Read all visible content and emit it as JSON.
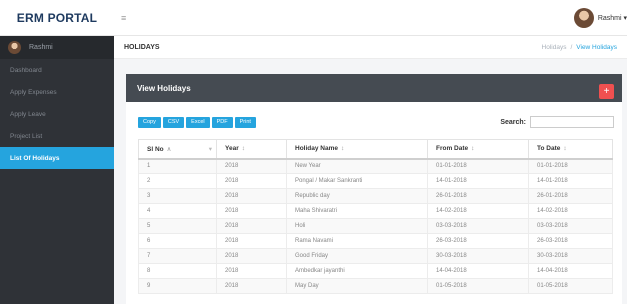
{
  "app": {
    "brand": "ERM PORTAL",
    "menu_icon": "≡",
    "user_name": "Rashmi ▾"
  },
  "sidebar": {
    "profile_name": "Rashmi",
    "items": [
      {
        "label": "Dashboard",
        "active": false
      },
      {
        "label": "Apply Expenses",
        "active": false
      },
      {
        "label": "Apply Leave",
        "active": false
      },
      {
        "label": "Project List",
        "active": false
      },
      {
        "label": "List Of Holidays",
        "active": true
      }
    ]
  },
  "page": {
    "title": "HOLIDAYS",
    "breadcrumb": [
      "Holidays",
      "View Holidays"
    ]
  },
  "panel": {
    "title": "View Holidays",
    "add_icon": "+",
    "buttons": [
      "Copy",
      "CSV",
      "Excel",
      "PDF",
      "Print"
    ],
    "search_label": "Search:",
    "search_value": ""
  },
  "table": {
    "headers": [
      {
        "label": "Sl No",
        "sort": "∧"
      },
      {
        "label": "Year",
        "sort": "↕"
      },
      {
        "label": "Holiday Name",
        "sort": "↕"
      },
      {
        "label": "From Date",
        "sort": "↕"
      },
      {
        "label": "To Date",
        "sort": "↕"
      }
    ],
    "rows": [
      [
        "1",
        "2018",
        "New Year",
        "01-01-2018",
        "01-01-2018"
      ],
      [
        "2",
        "2018",
        "Pongal / Makar Sankranti",
        "14-01-2018",
        "14-01-2018"
      ],
      [
        "3",
        "2018",
        "Republic day",
        "26-01-2018",
        "26-01-2018"
      ],
      [
        "4",
        "2018",
        "Maha Shivaratri",
        "14-02-2018",
        "14-02-2018"
      ],
      [
        "5",
        "2018",
        "Holi",
        "03-03-2018",
        "03-03-2018"
      ],
      [
        "6",
        "2018",
        "Rama Navami",
        "26-03-2018",
        "26-03-2018"
      ],
      [
        "7",
        "2018",
        "Good Friday",
        "30-03-2018",
        "30-03-2018"
      ],
      [
        "8",
        "2018",
        "Ambedkar jayanthi",
        "14-04-2018",
        "14-04-2018"
      ],
      [
        "9",
        "2018",
        "May Day",
        "01-05-2018",
        "01-05-2018"
      ]
    ]
  },
  "colors": {
    "accent": "#25a4de",
    "sidebar_bg": "#2f3237",
    "panel_header": "#454b52",
    "add_button": "#f05050",
    "brand_text": "#1e3a5f"
  }
}
